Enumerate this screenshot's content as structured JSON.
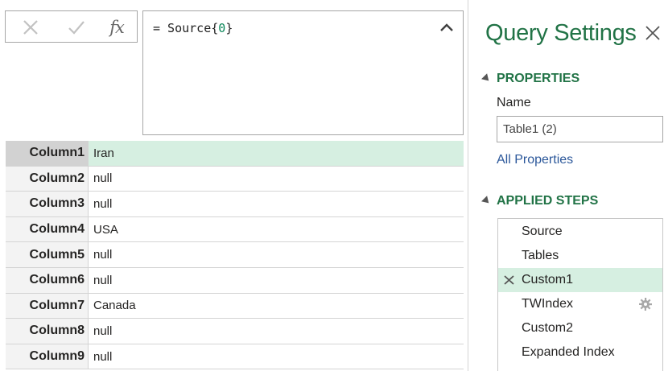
{
  "formula_bar": {
    "cancel_icon": "x-icon",
    "commit_icon": "checkmark-icon",
    "fx_label": "fx",
    "formula_prefix": "= Source{",
    "formula_index": "0",
    "formula_suffix": "}",
    "collapse_icon": "chevron-up-icon"
  },
  "record": {
    "rows": [
      {
        "field": "Column1",
        "value": "Iran",
        "selected": true
      },
      {
        "field": "Column2",
        "value": "null"
      },
      {
        "field": "Column3",
        "value": "null"
      },
      {
        "field": "Column4",
        "value": "USA"
      },
      {
        "field": "Column5",
        "value": "null"
      },
      {
        "field": "Column6",
        "value": "null"
      },
      {
        "field": "Column7",
        "value": "Canada"
      },
      {
        "field": "Column8",
        "value": "null"
      },
      {
        "field": "Column9",
        "value": "null"
      }
    ]
  },
  "query_settings": {
    "title": "Query Settings",
    "close_icon": "close-icon",
    "properties_header": "PROPERTIES",
    "name_label": "Name",
    "name_value": "Table1 (2)",
    "all_properties_link": "All Properties",
    "applied_steps_header": "APPLIED STEPS",
    "steps": [
      {
        "label": "Source"
      },
      {
        "label": "Tables"
      },
      {
        "label": "Custom1",
        "selected": true,
        "icon": "delete-step-icon"
      },
      {
        "label": "TWIndex",
        "icon": "gear-icon"
      },
      {
        "label": "Custom2"
      },
      {
        "label": "Expanded Index"
      }
    ],
    "accent_color": "#217346",
    "selection_color": "#d6efe1"
  }
}
